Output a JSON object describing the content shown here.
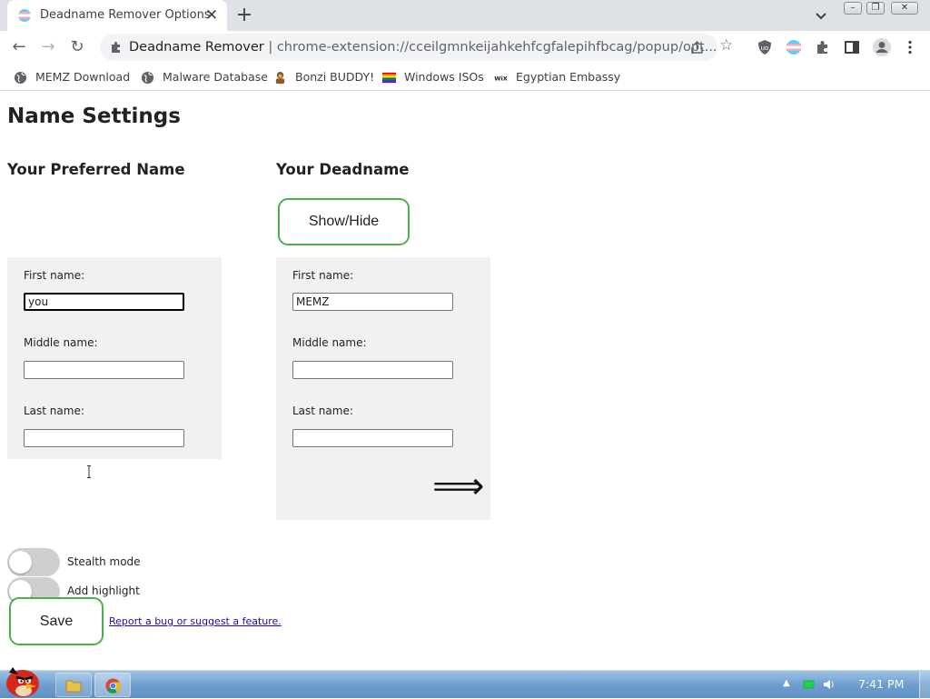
{
  "browser": {
    "tab_title": "Deadname Remover Options",
    "tab_close": "✕",
    "new_tab": "+",
    "omnibox_site": "Deadname Remover",
    "omnibox_separator": "|",
    "omnibox_url": "chrome-extension://cceilgmnkeijahkehfcgfalepihfbcag/popup/opt...",
    "nav": {
      "back": "←",
      "forward": "→",
      "reload": "↻"
    },
    "star": "☆",
    "window_controls": {
      "minimize": "–",
      "maximize": "❐",
      "close": "✕"
    }
  },
  "bookmarks": [
    {
      "label": "MEMZ Download",
      "icon": "globe-icon"
    },
    {
      "label": "Malware Database",
      "icon": "globe-icon"
    },
    {
      "label": "Bonzi BUDDY!",
      "icon": "bonzi-icon"
    },
    {
      "label": "Windows ISOs",
      "icon": "rainbow-flag-icon"
    },
    {
      "label": "Egyptian Embassy",
      "icon": "wix-icon"
    }
  ],
  "page": {
    "title": "Name Settings",
    "preferred": {
      "heading": "Your Preferred Name",
      "first_label": "First name:",
      "first_value": "you",
      "middle_label": "Middle name:",
      "middle_value": "",
      "last_label": "Last name:",
      "last_value": ""
    },
    "deadname": {
      "heading": "Your Deadname",
      "toggle_button": "Show/Hide",
      "first_label": "First name:",
      "first_value": "MEMZ",
      "middle_label": "Middle name:",
      "middle_value": "",
      "last_label": "Last name:",
      "last_value": "",
      "arrow": "⟹"
    },
    "stealth_mode_label": "Stealth mode",
    "stealth_mode_on": false,
    "highlight_label": "Add highlight",
    "highlight_on": false,
    "save_label": "Save",
    "report_link": "Report a bug or suggest a feature."
  },
  "taskbar": {
    "time": "7:41 PM",
    "tray_arrow": "▲"
  },
  "colors": {
    "accent_green": "#4caf50",
    "panel_bg": "#f1f1f1",
    "tab_strip": "#dee1e6",
    "link": "#1a0dab"
  }
}
